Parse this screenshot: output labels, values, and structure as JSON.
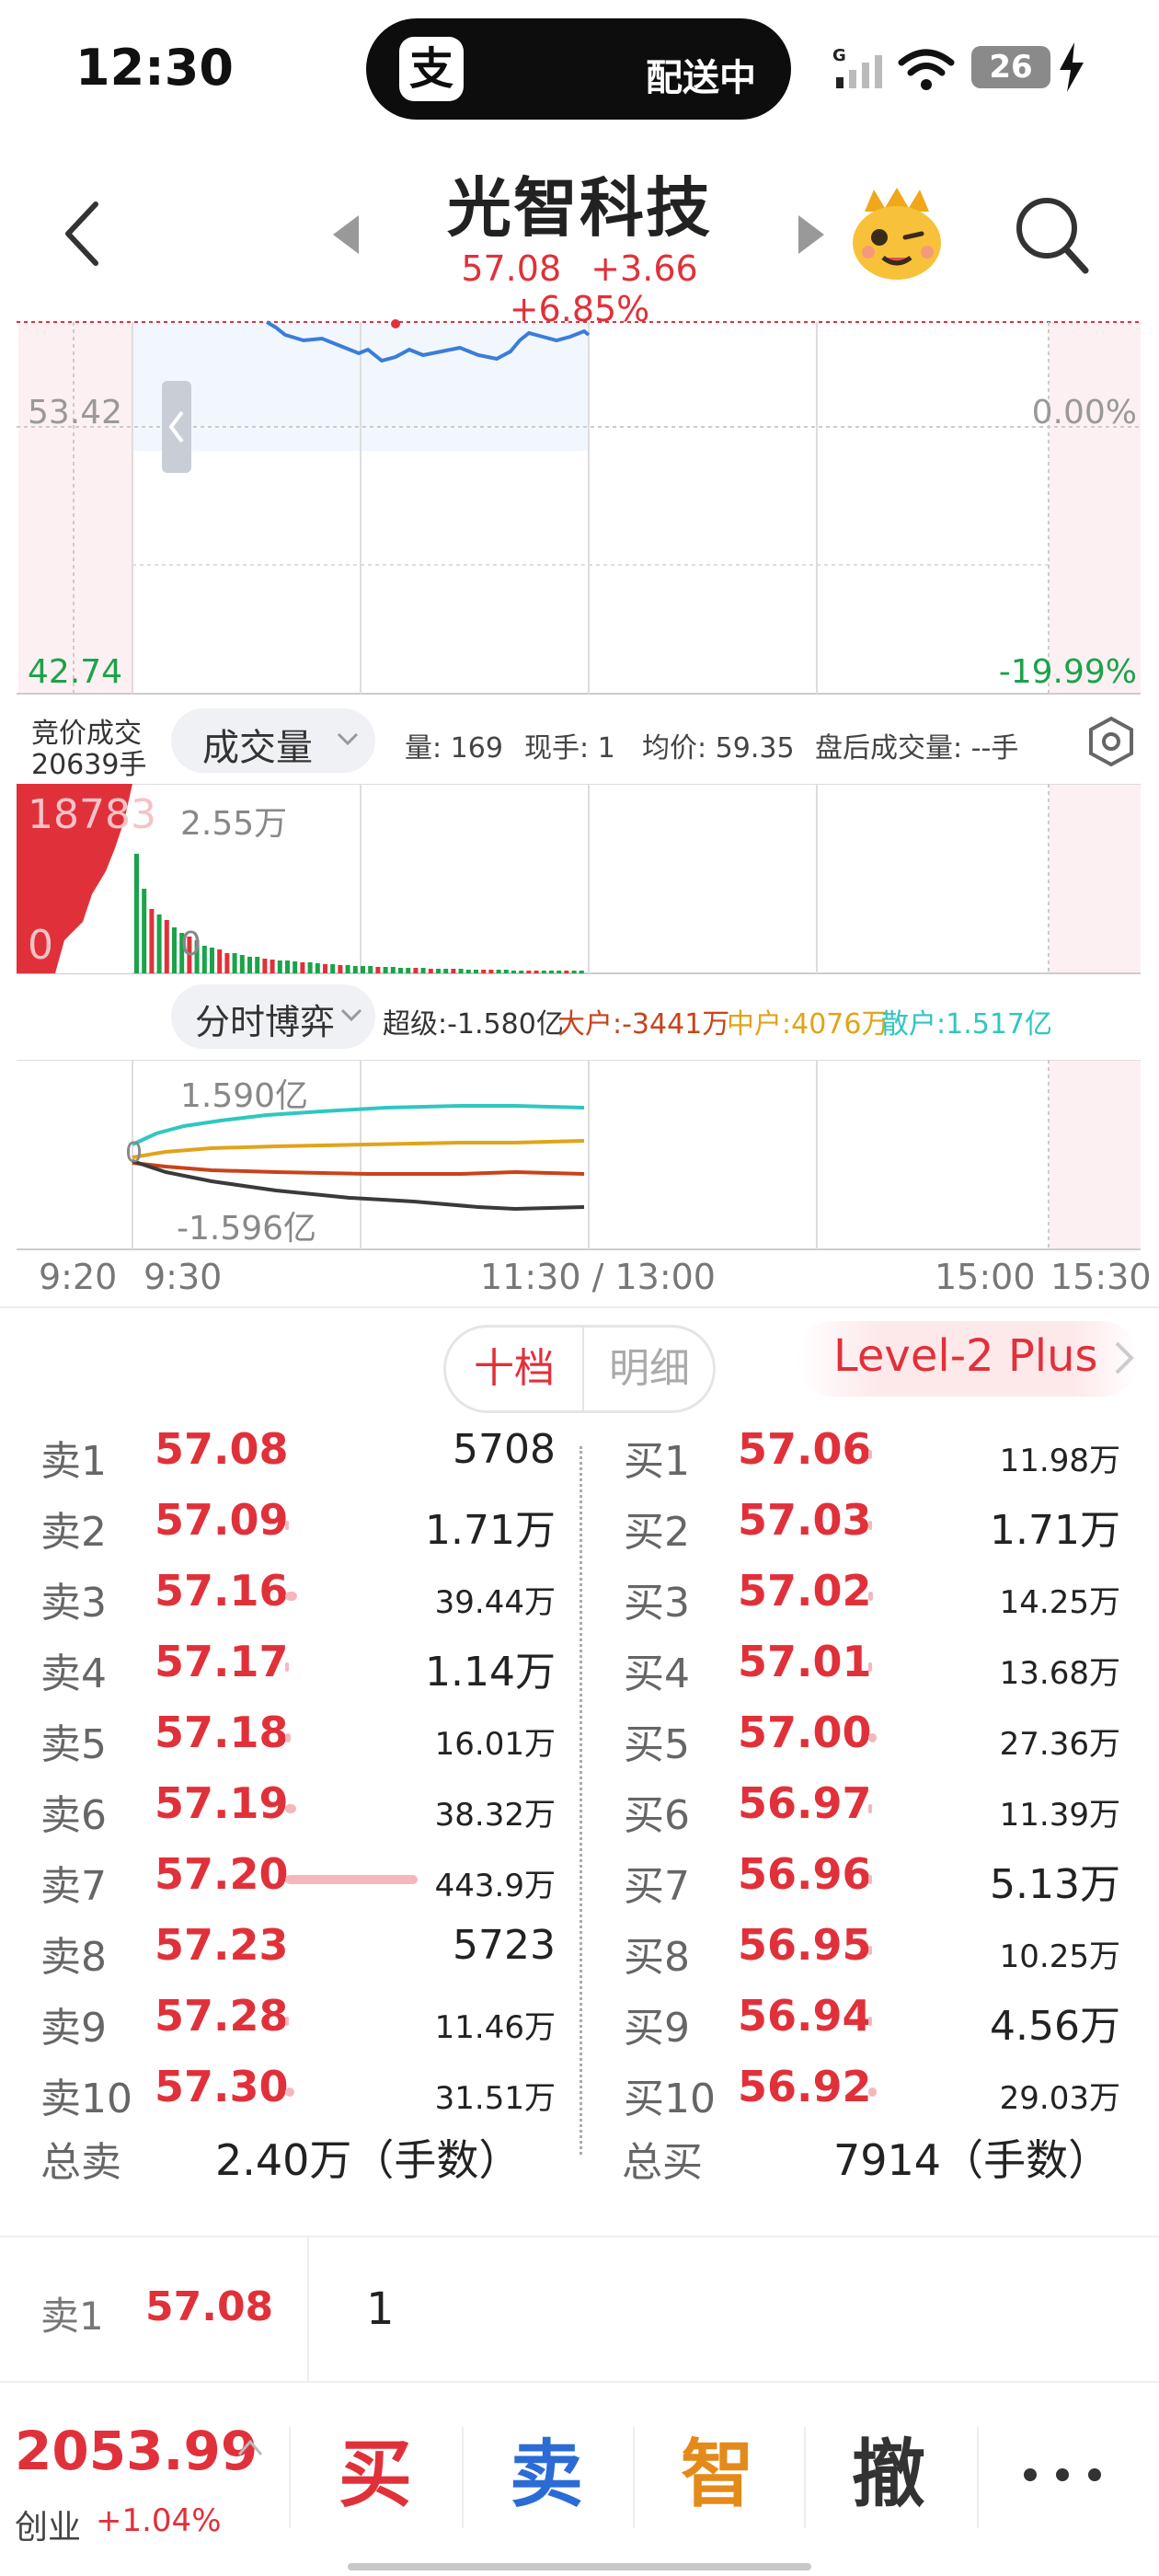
{
  "status_bar": {
    "time": "12:30",
    "pill_icon": "支",
    "pill_text": "配送中",
    "battery": "26"
  },
  "header": {
    "stock_name": "光智科技",
    "price": "57.08",
    "change": "+3.66",
    "change_pct": "+6.85%"
  },
  "chart": {
    "price_left_mid": "53.42",
    "price_left_low": "42.74",
    "pct_right_mid": "0.00%",
    "pct_right_low": "-19.99%",
    "auction_label": "竞价成交",
    "auction_volume": "20639手",
    "volume_selector": "成交量",
    "volume_info": {
      "vol": "量: 169",
      "current": "现手: 1",
      "avg": "均价: 59.35",
      "after_hours": "盘后成交量: --手"
    },
    "vol_left_max": "18783",
    "vol_left_zero": "0",
    "vol_max": "2.55万",
    "vol_zero": "0",
    "flow_selector": "分时博弈",
    "flow_info": {
      "super": "超级:-1.580亿",
      "large": "大户:-3441万",
      "medium": "中户:4076万",
      "retail": "散户:1.517亿"
    },
    "flow_max": "1.590亿",
    "flow_zero": "0",
    "flow_min": "-1.596亿",
    "time_labels": [
      "9:20",
      "9:30",
      "11:30 / 13:00",
      "15:00",
      "15:30"
    ],
    "colors": {
      "up": "#e0313a",
      "down": "#1aa34a",
      "price_line": "#3b7dd8",
      "super": "#3a3a3a",
      "large": "#c8431a",
      "medium": "#e0a41a",
      "retail": "#2fc7c0"
    }
  },
  "order_book": {
    "tabs": [
      "十档",
      "明细"
    ],
    "level2": "Level-2 Plus",
    "asks": [
      {
        "label": "卖1",
        "price": "57.08",
        "qty": "5708",
        "bar": 0
      },
      {
        "label": "卖2",
        "price": "57.09",
        "qty": "1.71万",
        "bar": 0.004
      },
      {
        "label": "卖3",
        "price": "57.16",
        "qty": "39.44万",
        "bar": 0.09
      },
      {
        "label": "卖4",
        "price": "57.17",
        "qty": "1.14万",
        "bar": 0.003
      },
      {
        "label": "卖5",
        "price": "57.18",
        "qty": "16.01万",
        "bar": 0.04
      },
      {
        "label": "卖6",
        "price": "57.19",
        "qty": "38.32万",
        "bar": 0.086
      },
      {
        "label": "卖7",
        "price": "57.20",
        "qty": "443.9万",
        "bar": 1.0
      },
      {
        "label": "卖8",
        "price": "57.23",
        "qty": "5723",
        "bar": 0
      },
      {
        "label": "卖9",
        "price": "57.28",
        "qty": "11.46万",
        "bar": 0.026
      },
      {
        "label": "卖10",
        "price": "57.30",
        "qty": "31.51万",
        "bar": 0.07
      }
    ],
    "bids": [
      {
        "label": "买1",
        "price": "57.06",
        "qty": "11.98万",
        "bar": 0.027
      },
      {
        "label": "买2",
        "price": "57.03",
        "qty": "1.71万",
        "bar": 0.004
      },
      {
        "label": "买3",
        "price": "57.02",
        "qty": "14.25万",
        "bar": 0.032
      },
      {
        "label": "买4",
        "price": "57.01",
        "qty": "13.68万",
        "bar": 0.031
      },
      {
        "label": "买5",
        "price": "57.00",
        "qty": "27.36万",
        "bar": 0.062
      },
      {
        "label": "买6",
        "price": "56.97",
        "qty": "11.39万",
        "bar": 0.026
      },
      {
        "label": "买7",
        "price": "56.96",
        "qty": "5.13万",
        "bar": 0.012
      },
      {
        "label": "买8",
        "price": "56.95",
        "qty": "10.25万",
        "bar": 0.023
      },
      {
        "label": "买9",
        "price": "56.94",
        "qty": "4.56万",
        "bar": 0.01
      },
      {
        "label": "买10",
        "price": "56.92",
        "qty": "29.03万",
        "bar": 0.065
      }
    ],
    "total_sell_label": "总卖",
    "total_sell": "2.40万（手数）",
    "total_buy_label": "总买",
    "total_buy": "7914（手数）"
  },
  "selected_order": {
    "label": "卖1",
    "price": "57.08",
    "qty": "1"
  },
  "bottom": {
    "index_value": "2053.99",
    "index_name": "创业",
    "index_change": "+1.04%",
    "actions": [
      "买",
      "卖",
      "智",
      "撤"
    ],
    "action_colors": [
      "#e0313a",
      "#2b6bd6",
      "#e38a1a",
      "#333333"
    ]
  }
}
